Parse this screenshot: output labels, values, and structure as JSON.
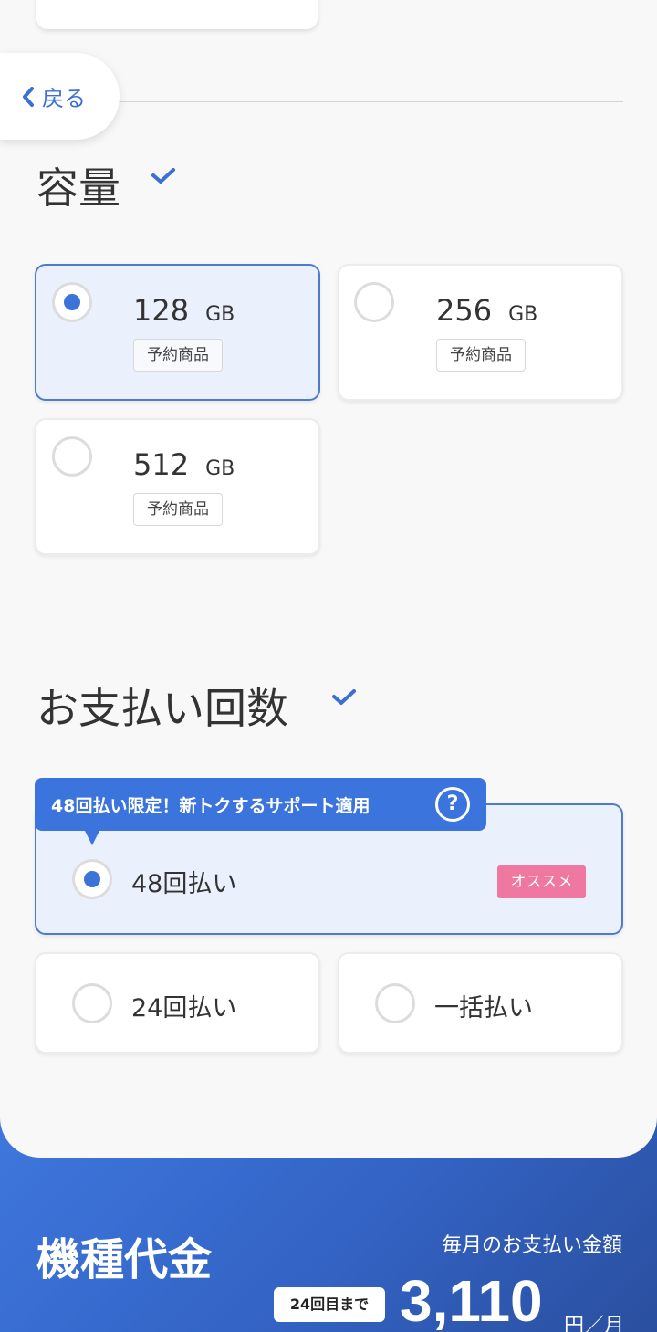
{
  "nav": {
    "back_label": "戻る"
  },
  "capacity": {
    "title": "容量",
    "options": [
      {
        "value": "128",
        "unit": "GB",
        "tag": "予約商品",
        "selected": true
      },
      {
        "value": "256",
        "unit": "GB",
        "tag": "予約商品",
        "selected": false
      },
      {
        "value": "512",
        "unit": "GB",
        "tag": "予約商品",
        "selected": false
      }
    ]
  },
  "payment": {
    "title": "お支払い回数",
    "banner": "48回払い限定！新トクするサポート適用",
    "help_glyph": "?",
    "options": [
      {
        "label": "48回払い",
        "badge": "オススメ",
        "selected": true
      },
      {
        "label": "24回払い",
        "selected": false
      },
      {
        "label": "一括払い",
        "selected": false
      }
    ]
  },
  "price_footer": {
    "title": "機種代金",
    "subtitle": "毎月のお支払い金額",
    "until_label": "24回目まで",
    "amount": "3,110",
    "unit": "円／月"
  },
  "colors": {
    "accent": "#3b74dc",
    "selected_bg": "#eaf1fd",
    "badge_pink": "#ef78a0",
    "footer_bg": "#3363c4"
  },
  "icons": {
    "back": "chevron-left-icon",
    "check": "check-icon",
    "help": "question-circle-icon"
  }
}
